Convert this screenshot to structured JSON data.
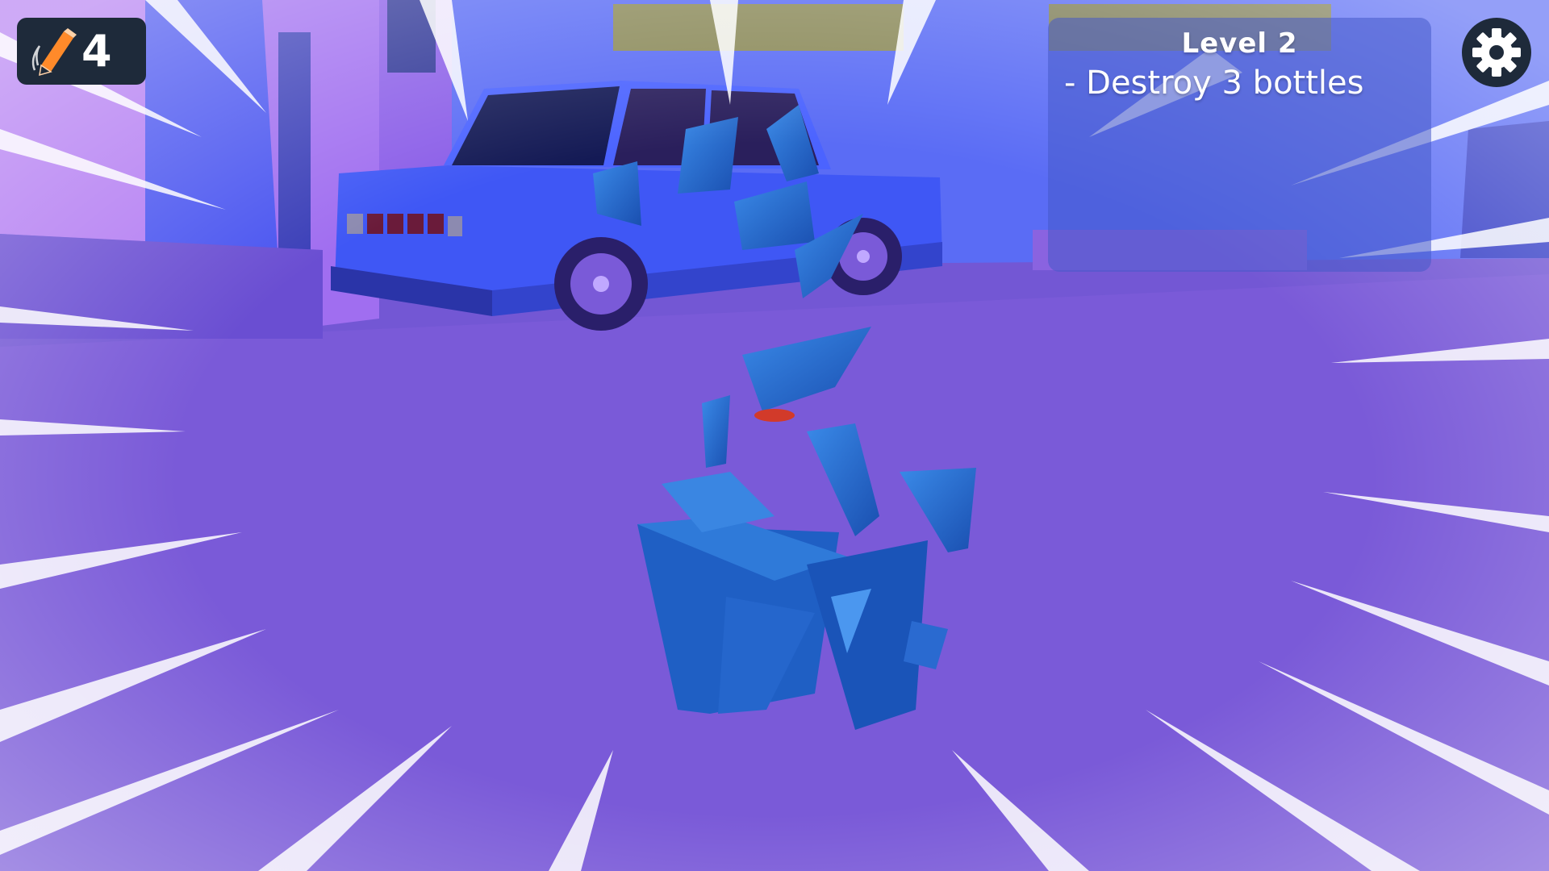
{
  "hud": {
    "pencil_count": "4",
    "pencil_icon": "pencil-icon"
  },
  "objective": {
    "level_title": "Level 2",
    "task": "- Destroy 3 bottles"
  },
  "settings": {
    "icon": "gear-icon"
  },
  "colors": {
    "ground": "#7a5ad8",
    "sky": "#5a6cf5",
    "car_body": "#3f57f5",
    "glass_shards": "#1f6fd1",
    "hud_bg": "#1e2a3a",
    "pencil_orange": "#ff8a2a"
  }
}
